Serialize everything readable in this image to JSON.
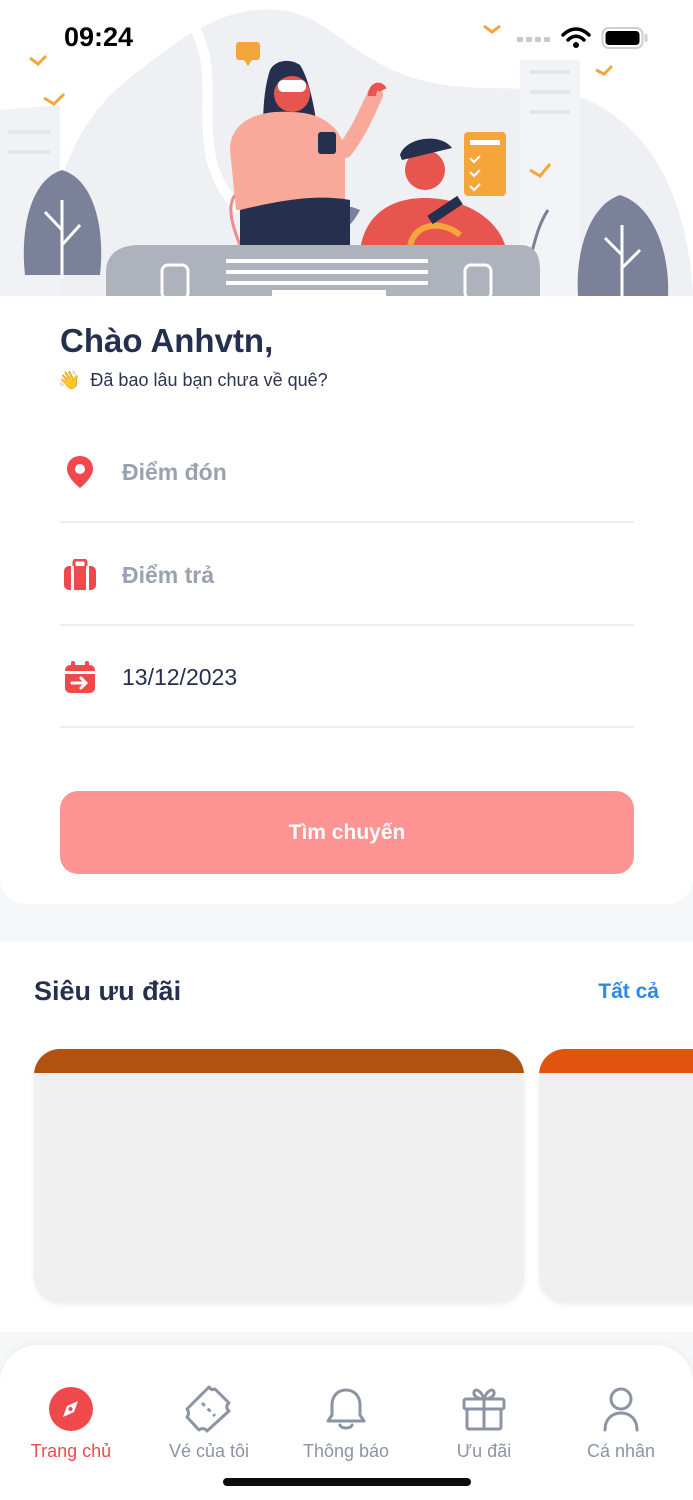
{
  "status_bar": {
    "time": "09:24"
  },
  "greeting": {
    "title": "Chào Anhvtn,",
    "emoji": "👋",
    "subtitle": "Đã bao lâu bạn chưa về quê?"
  },
  "search": {
    "pickup_placeholder": "Điểm đón",
    "dropoff_placeholder": "Điểm trả",
    "date_value": "13/12/2023",
    "button_label": "Tìm chuyến"
  },
  "promotions": {
    "title": "Siêu ưu đãi",
    "see_all_label": "Tất cả"
  },
  "bottom_nav": {
    "items": [
      {
        "label": "Trang chủ",
        "icon": "compass-icon",
        "active": true
      },
      {
        "label": "Vé của tôi",
        "icon": "ticket-icon",
        "active": false
      },
      {
        "label": "Thông báo",
        "icon": "bell-icon",
        "active": false
      },
      {
        "label": "Ưu đãi",
        "icon": "gift-icon",
        "active": false
      },
      {
        "label": "Cá nhân",
        "icon": "user-icon",
        "active": false
      }
    ]
  },
  "colors": {
    "accent": "#f0494b",
    "button": "#fd9493",
    "link": "#2b8be6",
    "text_dark": "#25304f"
  }
}
